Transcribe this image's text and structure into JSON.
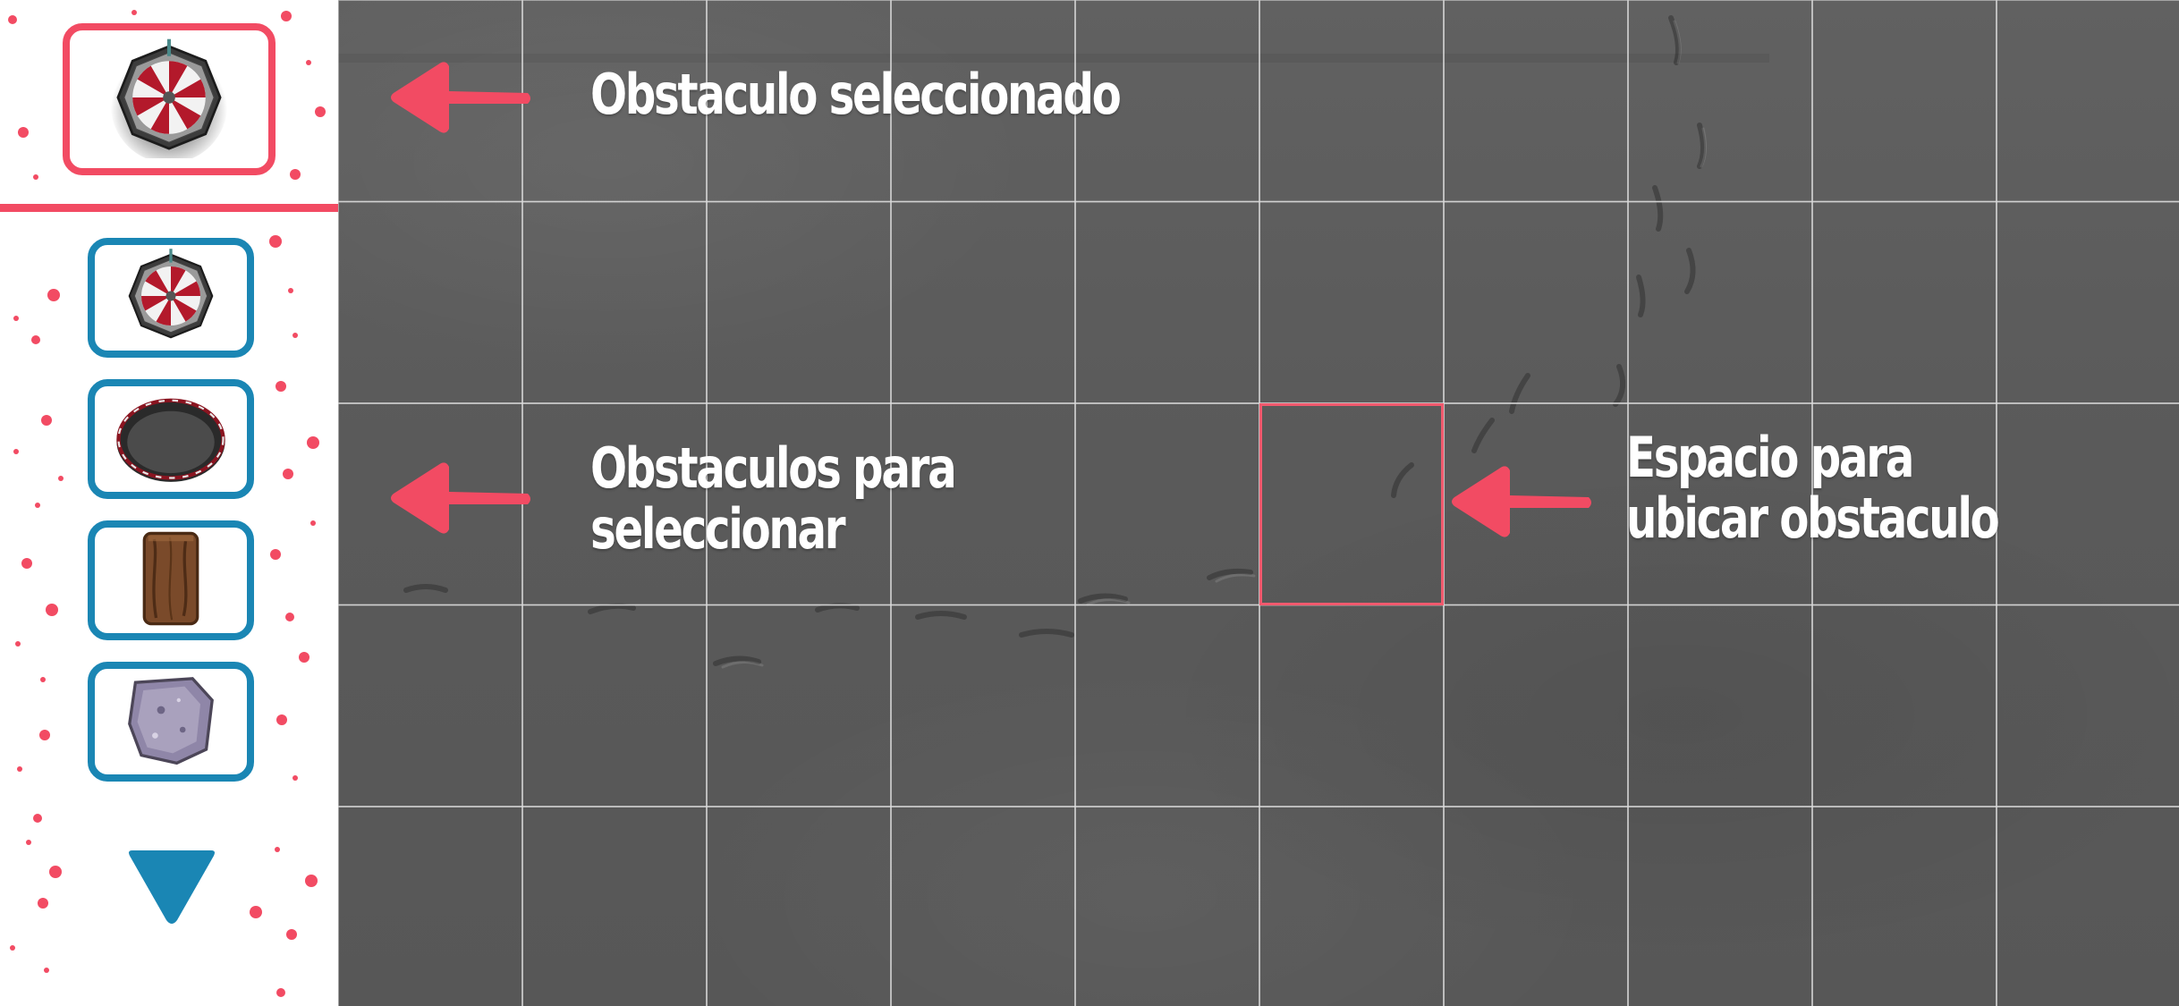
{
  "sidebar": {
    "selected_slot": {
      "icon": "dartboard-obstacle-icon"
    },
    "obstacle_options": [
      {
        "icon": "dartboard-obstacle-icon"
      },
      {
        "icon": "trampoline-obstacle-icon"
      },
      {
        "icon": "wooden-log-obstacle-icon"
      },
      {
        "icon": "stone-obstacle-icon"
      }
    ],
    "scroll_icon": "triangle-down-icon"
  },
  "board": {
    "columns": 10,
    "rows": 5,
    "highlighted_cell": {
      "row": 3,
      "column": 6
    }
  },
  "annotations": {
    "selected_label": "Obstaculo seleccionado",
    "options_label": [
      "Obstaculos para",
      "seleccionar"
    ],
    "space_label": [
      "Espacio para",
      "ubicar obstaculo"
    ]
  },
  "colors": {
    "accent_red": "#f24b63",
    "accent_blue": "#1a86b4",
    "sidebar_bg": "#ffffff",
    "board_gray": "#5b5b5b",
    "grid_line": "#d9d9d9"
  }
}
